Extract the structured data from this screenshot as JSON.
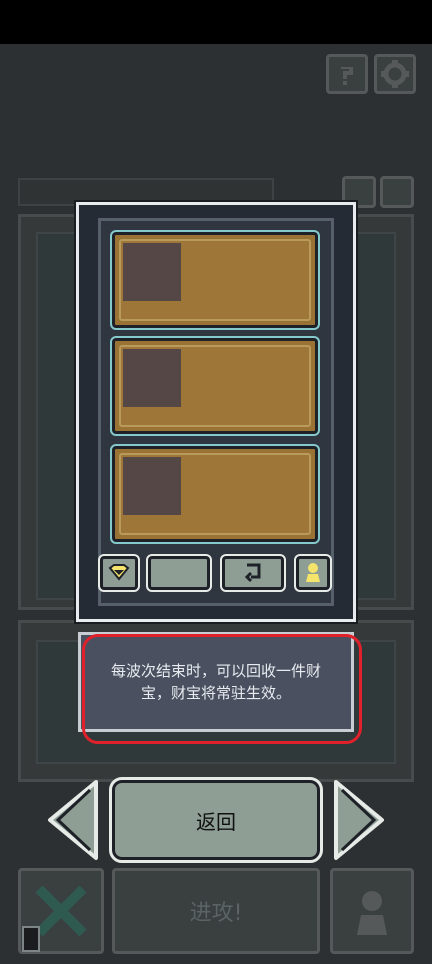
{
  "tooltip": {
    "line1": "每波次结束时，可以回收一件财",
    "line2": "宝，财宝将常驻生效。"
  },
  "buttons": {
    "back_label": "返回",
    "attack_label": "进攻!"
  },
  "colors": {
    "highlight_ring": "#e0202a",
    "card_gold": "#9a7334",
    "button_sage": "#8e9e94"
  },
  "icons": {
    "help": "help-icon",
    "settings": "gear-icon",
    "gem": "gem-icon",
    "recycle": "recycle-icon",
    "pawn": "pawn-icon",
    "close": "x-icon",
    "arrow_left": "arrow-left-icon",
    "arrow_right": "arrow-right-icon"
  }
}
